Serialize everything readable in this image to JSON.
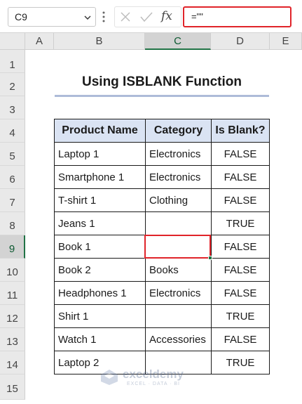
{
  "formula_bar": {
    "name_box": "C9",
    "fx_label": "fx",
    "formula": "=\"\""
  },
  "columns": [
    "A",
    "B",
    "C",
    "D",
    "E"
  ],
  "rows": [
    "1",
    "2",
    "3",
    "4",
    "5",
    "6",
    "7",
    "8",
    "9",
    "10",
    "11",
    "12",
    "13",
    "14",
    "15"
  ],
  "selected_column": "C",
  "selected_row": "9",
  "title": "Using ISBLANK Function",
  "table": {
    "headers": [
      "Product Name",
      "Category",
      "Is Blank?"
    ],
    "rows": [
      [
        "Laptop 1",
        "Electronics",
        "FALSE"
      ],
      [
        "Smartphone 1",
        "Electronics",
        "FALSE"
      ],
      [
        "T-shirt 1",
        "Clothing",
        "FALSE"
      ],
      [
        "Jeans 1",
        "",
        "TRUE"
      ],
      [
        "Book 1",
        "",
        "FALSE"
      ],
      [
        "Book 2",
        "Books",
        "FALSE"
      ],
      [
        "Headphones 1",
        "Electronics",
        "FALSE"
      ],
      [
        "Shirt 1",
        "",
        "TRUE"
      ],
      [
        "Watch 1",
        "Accessories",
        "FALSE"
      ],
      [
        "Laptop 2",
        "",
        "TRUE"
      ]
    ]
  },
  "watermark": {
    "brand": "exceldemy",
    "tagline": "EXCEL · DATA · BI"
  },
  "colors": {
    "header_fill": "#dae3f3",
    "highlight_red": "#e0242a",
    "excel_green": "#217346"
  }
}
